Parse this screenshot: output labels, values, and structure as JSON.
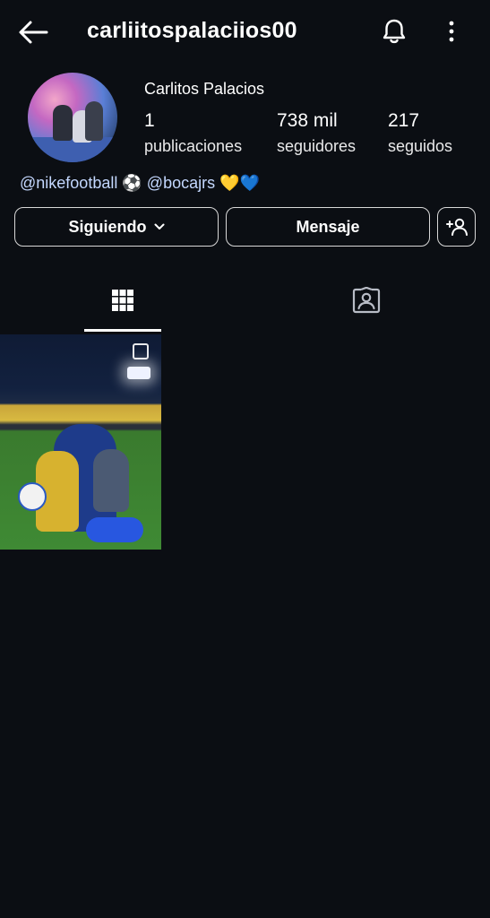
{
  "header": {
    "username": "carliitospalaciios00",
    "back_icon": "arrow-left-icon",
    "notification_icon": "bell-icon",
    "more_icon": "more-vertical-icon"
  },
  "profile": {
    "display_name": "Carlitos Palacios",
    "stats": {
      "posts": {
        "value": "1",
        "label": "publicaciones"
      },
      "followers": {
        "value": "738 mil",
        "label": "seguidores"
      },
      "following": {
        "value": "217",
        "label": "seguidos"
      }
    },
    "bio": {
      "mention1": "@nikefootball",
      "emoji1": "⚽",
      "mention2": "@bocajrs",
      "emoji2": "💛💙"
    }
  },
  "actions": {
    "following_label": "Siguiendo",
    "message_label": "Mensaje",
    "add_user_icon": "add-user-icon"
  },
  "tabs": {
    "grid_icon": "grid-icon",
    "tagged_icon": "tagged-user-icon",
    "active": "grid"
  },
  "colors": {
    "background": "#0b0e13",
    "text": "#ffffff",
    "mention": "#c4d8ff"
  }
}
